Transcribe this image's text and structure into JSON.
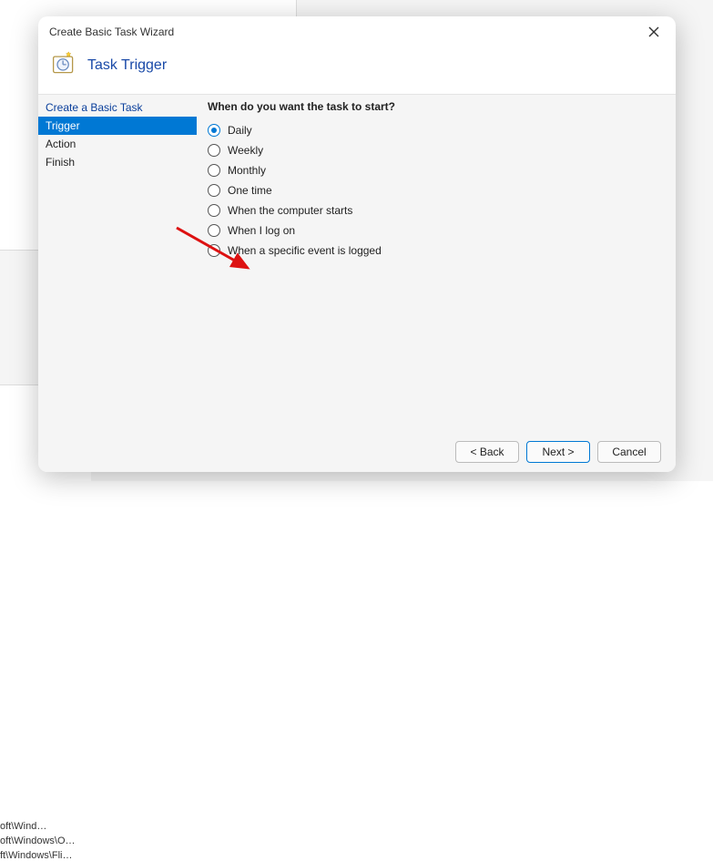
{
  "background": {
    "text1": "oft\\Wind…",
    "text2": "oft\\Windows\\O…",
    "text3": "ft\\Windows\\Fli…"
  },
  "dialog": {
    "title": "Create Basic Task Wizard",
    "header_title": "Task Trigger",
    "sidebar": {
      "items": [
        {
          "label": "Create a Basic Task",
          "active": false
        },
        {
          "label": "Trigger",
          "active": true
        },
        {
          "label": "Action",
          "active": false
        },
        {
          "label": "Finish",
          "active": false
        }
      ]
    },
    "content": {
      "prompt": "When do you want the task to start?",
      "options": [
        {
          "label": "Daily",
          "checked": true
        },
        {
          "label": "Weekly",
          "checked": false
        },
        {
          "label": "Monthly",
          "checked": false
        },
        {
          "label": "One time",
          "checked": false
        },
        {
          "label": "When the computer starts",
          "checked": false
        },
        {
          "label": "When I log on",
          "checked": false
        },
        {
          "label": "When a specific event is logged",
          "checked": false
        }
      ]
    },
    "footer": {
      "back": "< Back",
      "next": "Next >",
      "cancel": "Cancel"
    }
  }
}
